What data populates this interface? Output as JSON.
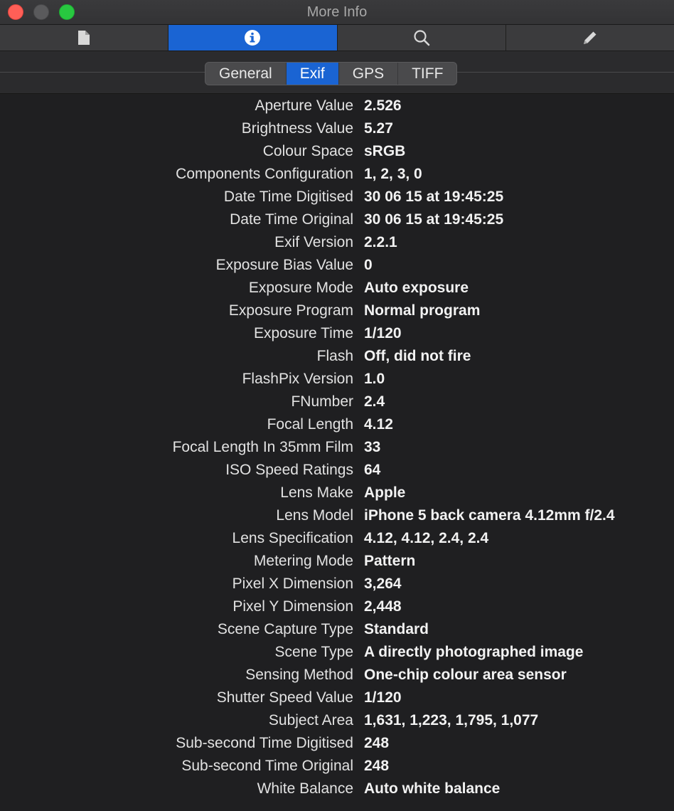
{
  "window": {
    "title": "More Info"
  },
  "toolbar": {
    "buttons": [
      {
        "icon": "document-icon",
        "active": false
      },
      {
        "icon": "info-icon",
        "active": true
      },
      {
        "icon": "search-icon",
        "active": false
      },
      {
        "icon": "pencil-icon",
        "active": false
      }
    ]
  },
  "tabs": [
    {
      "label": "General",
      "active": false
    },
    {
      "label": "Exif",
      "active": true
    },
    {
      "label": "GPS",
      "active": false
    },
    {
      "label": "TIFF",
      "active": false
    }
  ],
  "exif": [
    {
      "label": "Aperture Value",
      "value": "2.526"
    },
    {
      "label": "Brightness Value",
      "value": "5.27"
    },
    {
      "label": "Colour Space",
      "value": "sRGB"
    },
    {
      "label": "Components Configuration",
      "value": "1, 2, 3, 0"
    },
    {
      "label": "Date Time Digitised",
      "value": "30 06 15 at 19:45:25"
    },
    {
      "label": "Date Time Original",
      "value": "30 06 15 at 19:45:25"
    },
    {
      "label": "Exif Version",
      "value": "2.2.1"
    },
    {
      "label": "Exposure Bias Value",
      "value": "0"
    },
    {
      "label": "Exposure Mode",
      "value": "Auto exposure"
    },
    {
      "label": "Exposure Program",
      "value": "Normal program"
    },
    {
      "label": "Exposure Time",
      "value": "1/120"
    },
    {
      "label": "Flash",
      "value": "Off, did not fire"
    },
    {
      "label": "FlashPix Version",
      "value": "1.0"
    },
    {
      "label": "FNumber",
      "value": "2.4"
    },
    {
      "label": "Focal Length",
      "value": "4.12"
    },
    {
      "label": "Focal Length In 35mm Film",
      "value": "33"
    },
    {
      "label": "ISO Speed Ratings",
      "value": "64"
    },
    {
      "label": "Lens Make",
      "value": "Apple"
    },
    {
      "label": "Lens Model",
      "value": "iPhone 5 back camera 4.12mm f/2.4"
    },
    {
      "label": "Lens Specification",
      "value": "4.12, 4.12, 2.4, 2.4"
    },
    {
      "label": "Metering Mode",
      "value": "Pattern"
    },
    {
      "label": "Pixel X Dimension",
      "value": "3,264"
    },
    {
      "label": "Pixel Y Dimension",
      "value": "2,448"
    },
    {
      "label": "Scene Capture Type",
      "value": "Standard"
    },
    {
      "label": "Scene Type",
      "value": "A directly photographed image"
    },
    {
      "label": "Sensing Method",
      "value": "One-chip colour area sensor"
    },
    {
      "label": "Shutter Speed Value",
      "value": "1/120"
    },
    {
      "label": "Subject Area",
      "value": "1,631, 1,223, 1,795, 1,077"
    },
    {
      "label": "Sub-second Time Digitised",
      "value": "248"
    },
    {
      "label": "Sub-second Time Original",
      "value": "248"
    },
    {
      "label": "White Balance",
      "value": "Auto white balance"
    }
  ]
}
